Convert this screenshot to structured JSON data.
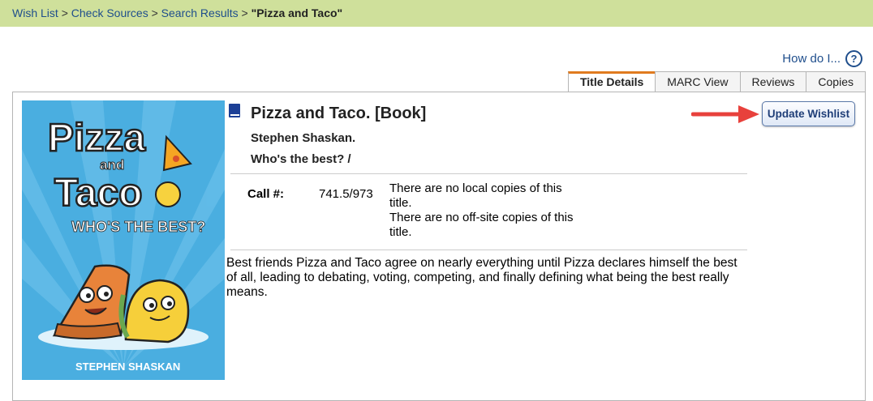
{
  "breadcrumb": {
    "items": [
      "Wish List",
      "Check Sources",
      "Search Results"
    ],
    "separator": ">",
    "current": "\"Pizza and Taco\""
  },
  "help": {
    "label": "How do I...",
    "icon": "question-circle-icon"
  },
  "tabs": [
    {
      "label": "Title Details",
      "active": true
    },
    {
      "label": "MARC View",
      "active": false
    },
    {
      "label": "Reviews",
      "active": false
    },
    {
      "label": "Copies",
      "active": false
    }
  ],
  "record": {
    "title": "Pizza and Taco. [Book]",
    "author": "Stephen Shaskan.",
    "subtitle": "Who's the best? /",
    "call_label": "Call #:",
    "call_number": "741.5/973",
    "local_copies": "There are no local copies of this title.",
    "offsite_copies": "There are no off-site copies of this title.",
    "description": "Best friends Pizza and Taco agree on nearly everything until Pizza declares himself the best of all, leading to debating, voting, competing, and finally defining what being the best really means.",
    "format_icon": "book-icon"
  },
  "cover": {
    "title_line1": "Pizza",
    "and": "and",
    "title_line2": "Taco",
    "tagline": "WHO'S THE BEST?",
    "author": "STEPHEN SHASKAN"
  },
  "actions": {
    "update_wishlist": "Update Wishlist"
  },
  "colors": {
    "breadcrumb_bar": "#cfe09b",
    "link": "#1f4e8c",
    "active_tab_accent": "#e07b1f",
    "arrow": "#e8413c"
  }
}
